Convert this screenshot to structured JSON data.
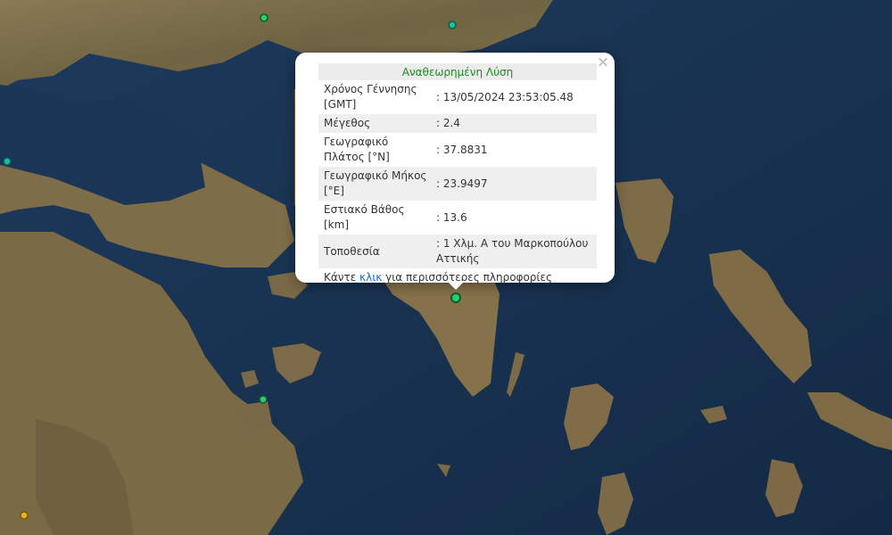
{
  "popup": {
    "title": "Αναθεωρημένη Λύση",
    "close_label": "×",
    "rows": [
      {
        "label": "Χρόνος Γέννησης [GMT]",
        "value": ": 13/05/2024 23:53:05.48"
      },
      {
        "label": "Μέγεθος",
        "value": ": 2.4"
      },
      {
        "label": "Γεωγραφικό Πλάτος [°N]",
        "value": ": 37.8831"
      },
      {
        "label": "Γεωγραφικό Μήκος [°E]",
        "value": ": 23.9497"
      },
      {
        "label": "Εστιακό Βάθος [km]",
        "value": ": 13.6"
      },
      {
        "label": "Τοποθεσία",
        "value": ": 1 Χλμ. Α του Μαρκοπούλου Αττικής"
      }
    ],
    "more_prefix": "Κάντε ",
    "more_link": "κλικ",
    "more_suffix": " για περισσότερες πληροφορίες"
  },
  "colors": {
    "sea": "#17314f",
    "land": "#7a6a4a",
    "marker_green": "#2ecc71",
    "marker_teal": "#1abc9c",
    "marker_yellow": "#e6b422",
    "title_text": "#1b8a1b",
    "link": "#1b6fb8"
  }
}
